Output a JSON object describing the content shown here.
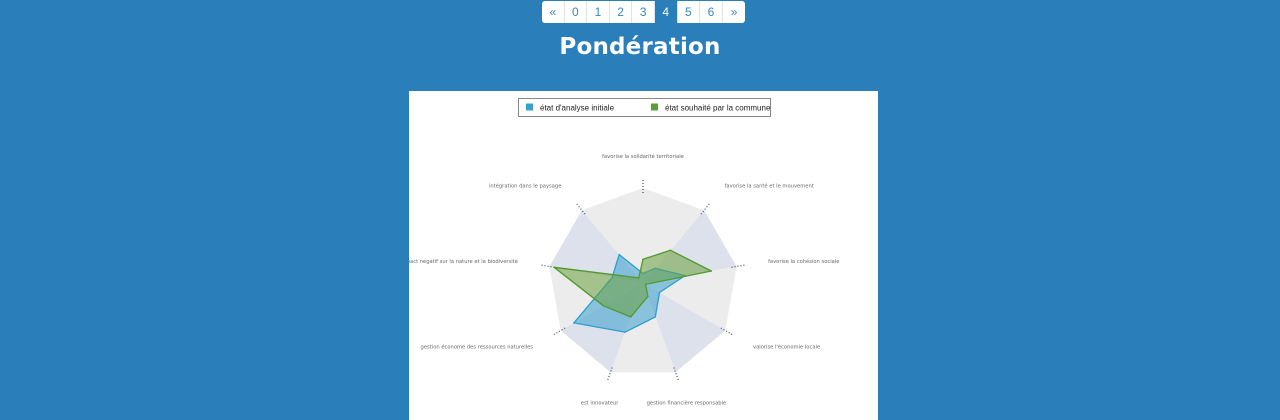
{
  "pagination": {
    "items": [
      "«",
      "0",
      "1",
      "2",
      "3",
      "4",
      "5",
      "6",
      "»"
    ],
    "active_index": 5
  },
  "page_title": "Pondération",
  "colors": {
    "background": "#2a7fba",
    "initial": "#3aa0d0",
    "desired": "#5a9e3a"
  },
  "chart_data": {
    "type": "radar",
    "legend": [
      "état d'analyse initiale",
      "état souhaité par la commune"
    ],
    "axes": [
      "favorise la solidarité territoriale",
      "favorise la santé et le mouvement",
      "favorise la cohésion sociale",
      "valorise l'économie locale",
      "gestion financière responsable",
      "est innovateur",
      "gestion économe des ressources naturelles",
      "faible impact négatif sur la nature et la biodiversité",
      "intégration dans le paysage"
    ],
    "rlim": [
      0,
      100
    ],
    "series": [
      {
        "name": "état d'analyse initiale",
        "color": "#3aa0d0",
        "values": [
          10,
          20,
          45,
          20,
          38,
          55,
          84,
          33,
          39
        ]
      },
      {
        "name": "état souhaité par la commune",
        "color": "#5a9e3a",
        "values": [
          25,
          45,
          73,
          3,
          15,
          38,
          48,
          95,
          7
        ]
      }
    ]
  }
}
